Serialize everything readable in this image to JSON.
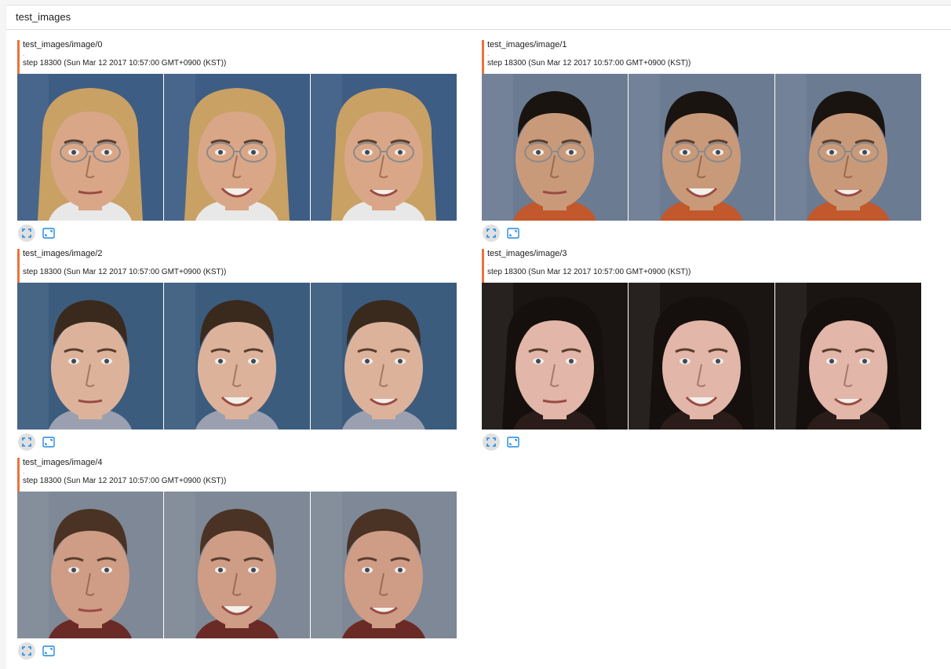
{
  "group": {
    "title": "test_images"
  },
  "cards": [
    {
      "tag": "test_images/image/0",
      "step": "step 18300 (Sun Mar 12 2017 10:57:00 GMT+0900 (KST))",
      "dot": "."
    },
    {
      "tag": "test_images/image/1",
      "step": "step 18300 (Sun Mar 12 2017 10:57:00 GMT+0900 (KST))",
      "dot": "."
    },
    {
      "tag": "test_images/image/2",
      "step": "step 18300 (Sun Mar 12 2017 10:57:00 GMT+0900 (KST))",
      "dot": "."
    },
    {
      "tag": "test_images/image/3",
      "step": "step 18300 (Sun Mar 12 2017 10:57:00 GMT+0900 (KST))",
      "dot": "."
    },
    {
      "tag": "test_images/image/4",
      "step": "step 18300 (Sun Mar 12 2017 10:57:00 GMT+0900 (KST))",
      "dot": "."
    }
  ],
  "icons": {
    "expand": "fullscreen-icon",
    "fit": "fit-to-size-icon"
  },
  "colors": {
    "accent": "#e8743b",
    "icon_blue": "#1e88e5",
    "button_bg": "#e0e0e0"
  },
  "faces": [
    {
      "skin": "#d9a788",
      "hair": "#c9a165",
      "bg": "#3d5d84",
      "shirt": "#e8e8e8",
      "glasses": true,
      "long_hair": true
    },
    {
      "skin": "#c99a7a",
      "hair": "#1a1410",
      "bg": "#6b7b92",
      "shirt": "#c2582b",
      "glasses": true,
      "long_hair": false
    },
    {
      "skin": "#dcb39a",
      "hair": "#3a2a1e",
      "bg": "#3c5c7e",
      "shirt": "#9aa0b0",
      "glasses": false,
      "long_hair": false
    },
    {
      "skin": "#e2b6a8",
      "hair": "#15100d",
      "bg": "#1a1512",
      "shirt": "#2a1c18",
      "glasses": false,
      "long_hair": true
    },
    {
      "skin": "#cf9c86",
      "hair": "#4a3324",
      "bg": "#7e8896",
      "shirt": "#6a2a26",
      "glasses": false,
      "long_hair": false
    }
  ]
}
